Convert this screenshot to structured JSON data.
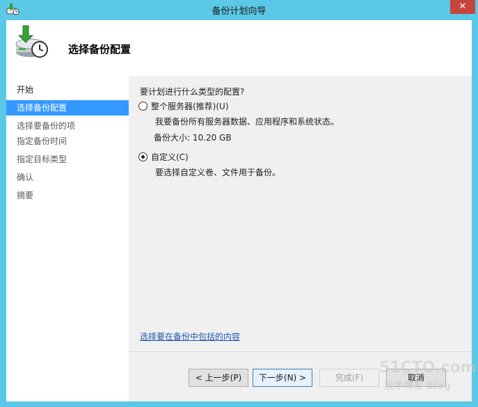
{
  "window": {
    "title": "备份计划向导",
    "close_glyph": "✕",
    "title_icon": "backup-wizard-icon"
  },
  "header": {
    "title": "选择备份配置",
    "icon": "backup-schedule-icon"
  },
  "sidebar": {
    "items": [
      {
        "label": "开始"
      },
      {
        "label": "选择备份配置"
      },
      {
        "label": "选择要备份的项"
      },
      {
        "label": "指定备份时间"
      },
      {
        "label": "指定目标类型"
      },
      {
        "label": "确认"
      },
      {
        "label": "摘要"
      }
    ],
    "active_index": 1
  },
  "content": {
    "question": "要计划进行什么类型的配置?",
    "options": [
      {
        "label": "整个服务器(推荐)(U)",
        "description": "我要备份所有服务器数据、应用程序和系统状态。",
        "detail": "备份大小: 10.20 GB",
        "selected": false
      },
      {
        "label": "自定义(C)",
        "description": "要选择自定义卷、文件用于备份。",
        "selected": true
      }
    ],
    "link": "选择要在备份中包括的内容"
  },
  "buttons": {
    "back": "< 上一步(P)",
    "next": "下一步(N) >",
    "finish": "完成(F)",
    "cancel": "取消"
  },
  "watermark": {
    "line1": "51CTO.com",
    "line2": "技术博客 Blog"
  },
  "colors": {
    "titlebar": "#5ac8e6",
    "close": "#c7463b",
    "nav_active": "#3399ff",
    "link": "#1f56b0"
  }
}
